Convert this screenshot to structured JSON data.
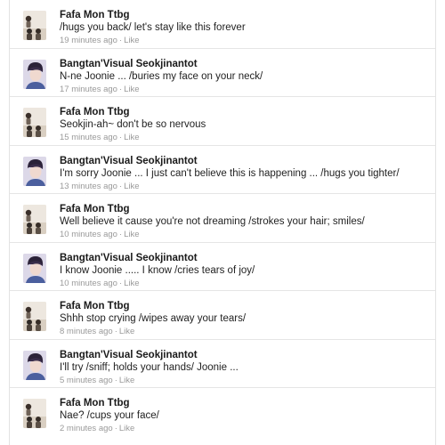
{
  "comments": [
    {
      "avatar": "group-photo",
      "name": "Fafa Mon Ttbg",
      "text": "/hugs you back/ let's stay like this forever",
      "time": "19 minutes ago",
      "sep": "·",
      "like": "Like"
    },
    {
      "avatar": "portrait-photo",
      "name": "Bangtan'Visual Seokjinantot",
      "text": "N-ne Joonie ... /buries my face on your neck/",
      "time": "17 minutes ago",
      "sep": "·",
      "like": "Like"
    },
    {
      "avatar": "group-photo",
      "name": "Fafa Mon Ttbg",
      "text": "Seokjin-ah~ don't be so nervous",
      "time": "15 minutes ago",
      "sep": "·",
      "like": "Like"
    },
    {
      "avatar": "portrait-photo",
      "name": "Bangtan'Visual Seokjinantot",
      "text": "I'm sorry Joonie ... I just can't believe this is happening ... /hugs you tighter/",
      "time": "13 minutes ago",
      "sep": "·",
      "like": "Like"
    },
    {
      "avatar": "group-photo",
      "name": "Fafa Mon Ttbg",
      "text": "Well believe it cause you're not dreaming /strokes your hair; smiles/",
      "time": "10 minutes ago",
      "sep": "·",
      "like": "Like"
    },
    {
      "avatar": "portrait-photo",
      "name": "Bangtan'Visual Seokjinantot",
      "text": "I know Joonie ..... I know /cries tears of joy/",
      "time": "10 minutes ago",
      "sep": "·",
      "like": "Like"
    },
    {
      "avatar": "group-photo",
      "name": "Fafa Mon Ttbg",
      "text": "Shhh stop crying /wipes away your tears/",
      "time": "8 minutes ago",
      "sep": "·",
      "like": "Like"
    },
    {
      "avatar": "portrait-photo",
      "name": "Bangtan'Visual Seokjinantot",
      "text": "I'll try /sniff; holds your hands/ Joonie ...",
      "time": "5 minutes ago",
      "sep": "·",
      "like": "Like"
    },
    {
      "avatar": "group-photo",
      "name": "Fafa Mon Ttbg",
      "text": "Nae? /cups your face/",
      "time": "2 minutes ago",
      "sep": "·",
      "like": "Like"
    }
  ]
}
